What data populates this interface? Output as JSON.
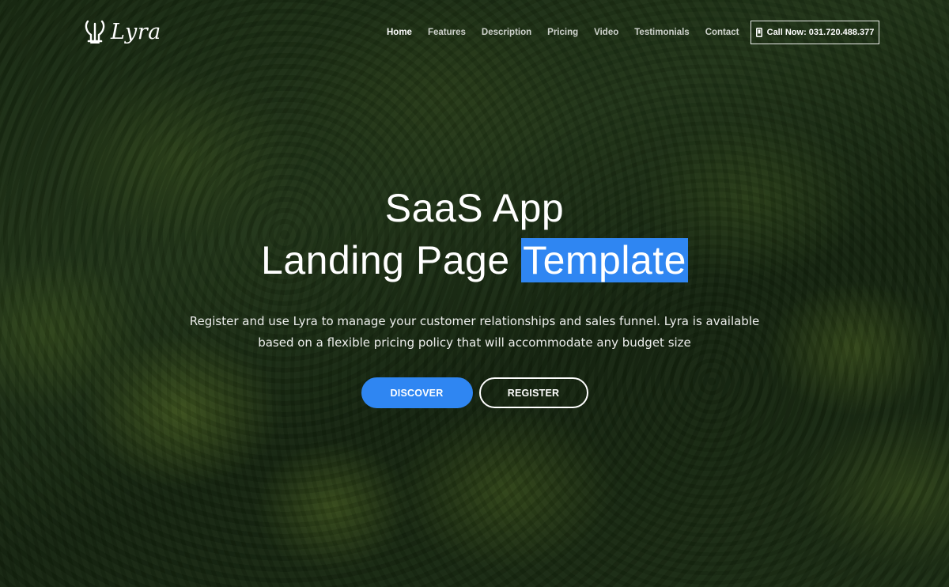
{
  "brand": {
    "name": "Lyra",
    "icon": "lyre-icon"
  },
  "nav": {
    "items": [
      {
        "label": "Home",
        "active": true
      },
      {
        "label": "Features",
        "active": false
      },
      {
        "label": "Description",
        "active": false
      },
      {
        "label": "Pricing",
        "active": false
      },
      {
        "label": "Video",
        "active": false
      },
      {
        "label": "Testimonials",
        "active": false
      },
      {
        "label": "Contact",
        "active": false
      }
    ],
    "call": {
      "label": "Call Now: 031.720.488.377",
      "icon": "phone-icon"
    }
  },
  "hero": {
    "title_line1": "SaaS App",
    "title_line2": "Landing Page",
    "title_highlight": "Template",
    "subtitle": "Register and use Lyra to manage your customer relationships and sales funnel. Lyra is available based on a flexible pricing policy that will accommodate any budget size",
    "discover_label": "DISCOVER",
    "register_label": "REGISTER"
  },
  "colors": {
    "accent": "#2f86f2",
    "text": "#ffffff"
  }
}
